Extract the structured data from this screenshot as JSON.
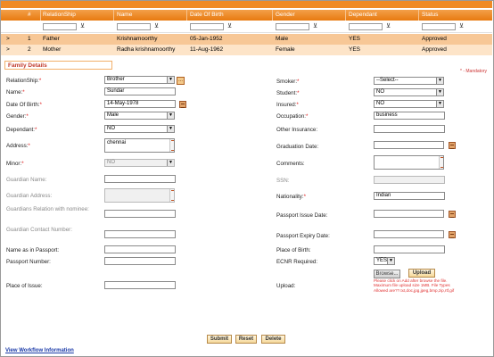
{
  "grid": {
    "columns": [
      "#",
      "RelationShip",
      "Name",
      "Date Of Birth",
      "Gender",
      "Dependant",
      "Status"
    ],
    "rows": [
      {
        "num": "1",
        "relationship": "Father",
        "name": "Krishnamoorthy",
        "dob": "05-Jan-1952",
        "gender": "Male",
        "dependant": "YES",
        "status": "Approved"
      },
      {
        "num": "2",
        "relationship": "Mother",
        "name": "Radha krishnamoorthy",
        "dob": "11-Aug-1962",
        "gender": "Female",
        "dependant": "YES",
        "status": "Approved"
      }
    ]
  },
  "section_title": "Family Details",
  "mandatory_note": "* - Mandatory",
  "left": {
    "relationship": {
      "label": "RelationShip:",
      "value": "Brother"
    },
    "name": {
      "label": "Name:",
      "value": "Sundar"
    },
    "dob": {
      "label": "Date Of Birth:",
      "value": "14-May-1978"
    },
    "gender": {
      "label": "Gender:",
      "value": "Male"
    },
    "dependant": {
      "label": "Dependant:",
      "value": "NO"
    },
    "address": {
      "label": "Address:",
      "value": "chennai"
    },
    "minor": {
      "label": "Minor:",
      "value": "NO"
    },
    "guardian_name": {
      "label": "Guardian Name:"
    },
    "guardian_address": {
      "label": "Guardian Address:"
    },
    "guardian_relation": {
      "label": "Guardians Relation with nominee:"
    },
    "guardian_contact": {
      "label": "Guardian Contact Number:"
    },
    "name_passport": {
      "label": "Name as in Passport:"
    },
    "passport_number": {
      "label": "Passport Number:"
    },
    "place_issue": {
      "label": "Place of Issue:"
    }
  },
  "right": {
    "smoker": {
      "label": "Smoker:",
      "value": "--Select--"
    },
    "student": {
      "label": "Student:",
      "value": "NO"
    },
    "insured": {
      "label": "Insured:",
      "value": "NO"
    },
    "occupation": {
      "label": "Occupation:",
      "value": "business"
    },
    "other_insurance": {
      "label": "Other Insurance:"
    },
    "graduation": {
      "label": "Graduation Date:"
    },
    "comments": {
      "label": "Comments:"
    },
    "ssn": {
      "label": "SSN:"
    },
    "nationality": {
      "label": "Nationality:",
      "value": "Indian"
    },
    "passport_issue": {
      "label": "Passport Issue Date:"
    },
    "passport_expiry": {
      "label": "Passport Expiry Date:"
    },
    "place_birth": {
      "label": "Place of Birth:"
    },
    "ecnr": {
      "label": "ECNR Required:",
      "value": "YES"
    },
    "upload": {
      "label": "Upload:"
    }
  },
  "upload": {
    "browse": "Browse...",
    "upload": "Upload",
    "note": "Please click on Add after browse the file. Maximum file upload size 1MB. File Types Allowed are??.txt,doc,jpg,jpeg,bmp,zip,rtf,gif"
  },
  "buttons": {
    "submit": "Submit",
    "reset": "Reset",
    "delete": "Delete"
  },
  "link": "View Workflow Information",
  "icons": {
    "dots": "...",
    "funnel": "▼̲"
  }
}
